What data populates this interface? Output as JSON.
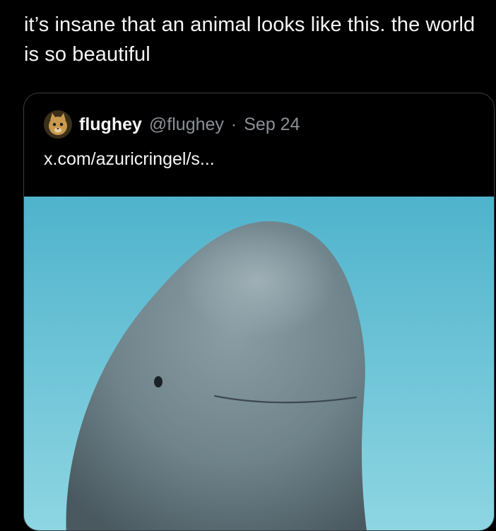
{
  "post": {
    "text": "it’s insane that an animal looks like this. the world is so beautiful"
  },
  "quoted_post": {
    "display_name": "flughey",
    "handle": "@flughey",
    "separator": "·",
    "date": "Sep 24",
    "link_text": "x.com/azuricringel/s...",
    "avatar_icon": "cartoon-cat-avatar"
  },
  "media": {
    "icon": "beluga-whale-photo",
    "colors": {
      "water_top": "#4fb3cc",
      "water_bottom": "#8fd6e3",
      "whale_light": "#8a9da4",
      "whale_dark": "#4a5960"
    }
  }
}
